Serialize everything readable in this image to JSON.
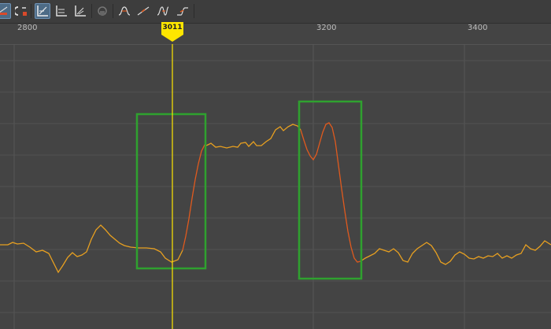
{
  "toolbar": {
    "buttons": [
      {
        "icon": "key-tangent-icon",
        "active": true
      },
      {
        "icon": "magnet-icon",
        "active": false
      },
      {
        "icon": "frame-all-icon",
        "active": true
      },
      {
        "icon": "frame-selected-icon",
        "active": false
      },
      {
        "icon": "normalize-icon",
        "active": false
      },
      {
        "icon": "lock-tangent-icon",
        "active": false
      },
      {
        "icon": "spline-tangent-icon",
        "active": false
      },
      {
        "icon": "linear-tangent-icon",
        "active": false
      },
      {
        "icon": "clamped-tangent-icon",
        "active": false
      },
      {
        "icon": "stepped-tangent-icon",
        "active": false
      }
    ]
  },
  "timeline": {
    "ruler_labels": [
      "2800",
      "3200",
      "3400"
    ],
    "current_frame": "3011"
  },
  "colors": {
    "background": "#444444",
    "grid": "#555555",
    "curve": "#e8a020",
    "curve_selected": "#e05a1e",
    "playhead": "#ffe600",
    "highlight_box": "#2fa12f"
  }
}
